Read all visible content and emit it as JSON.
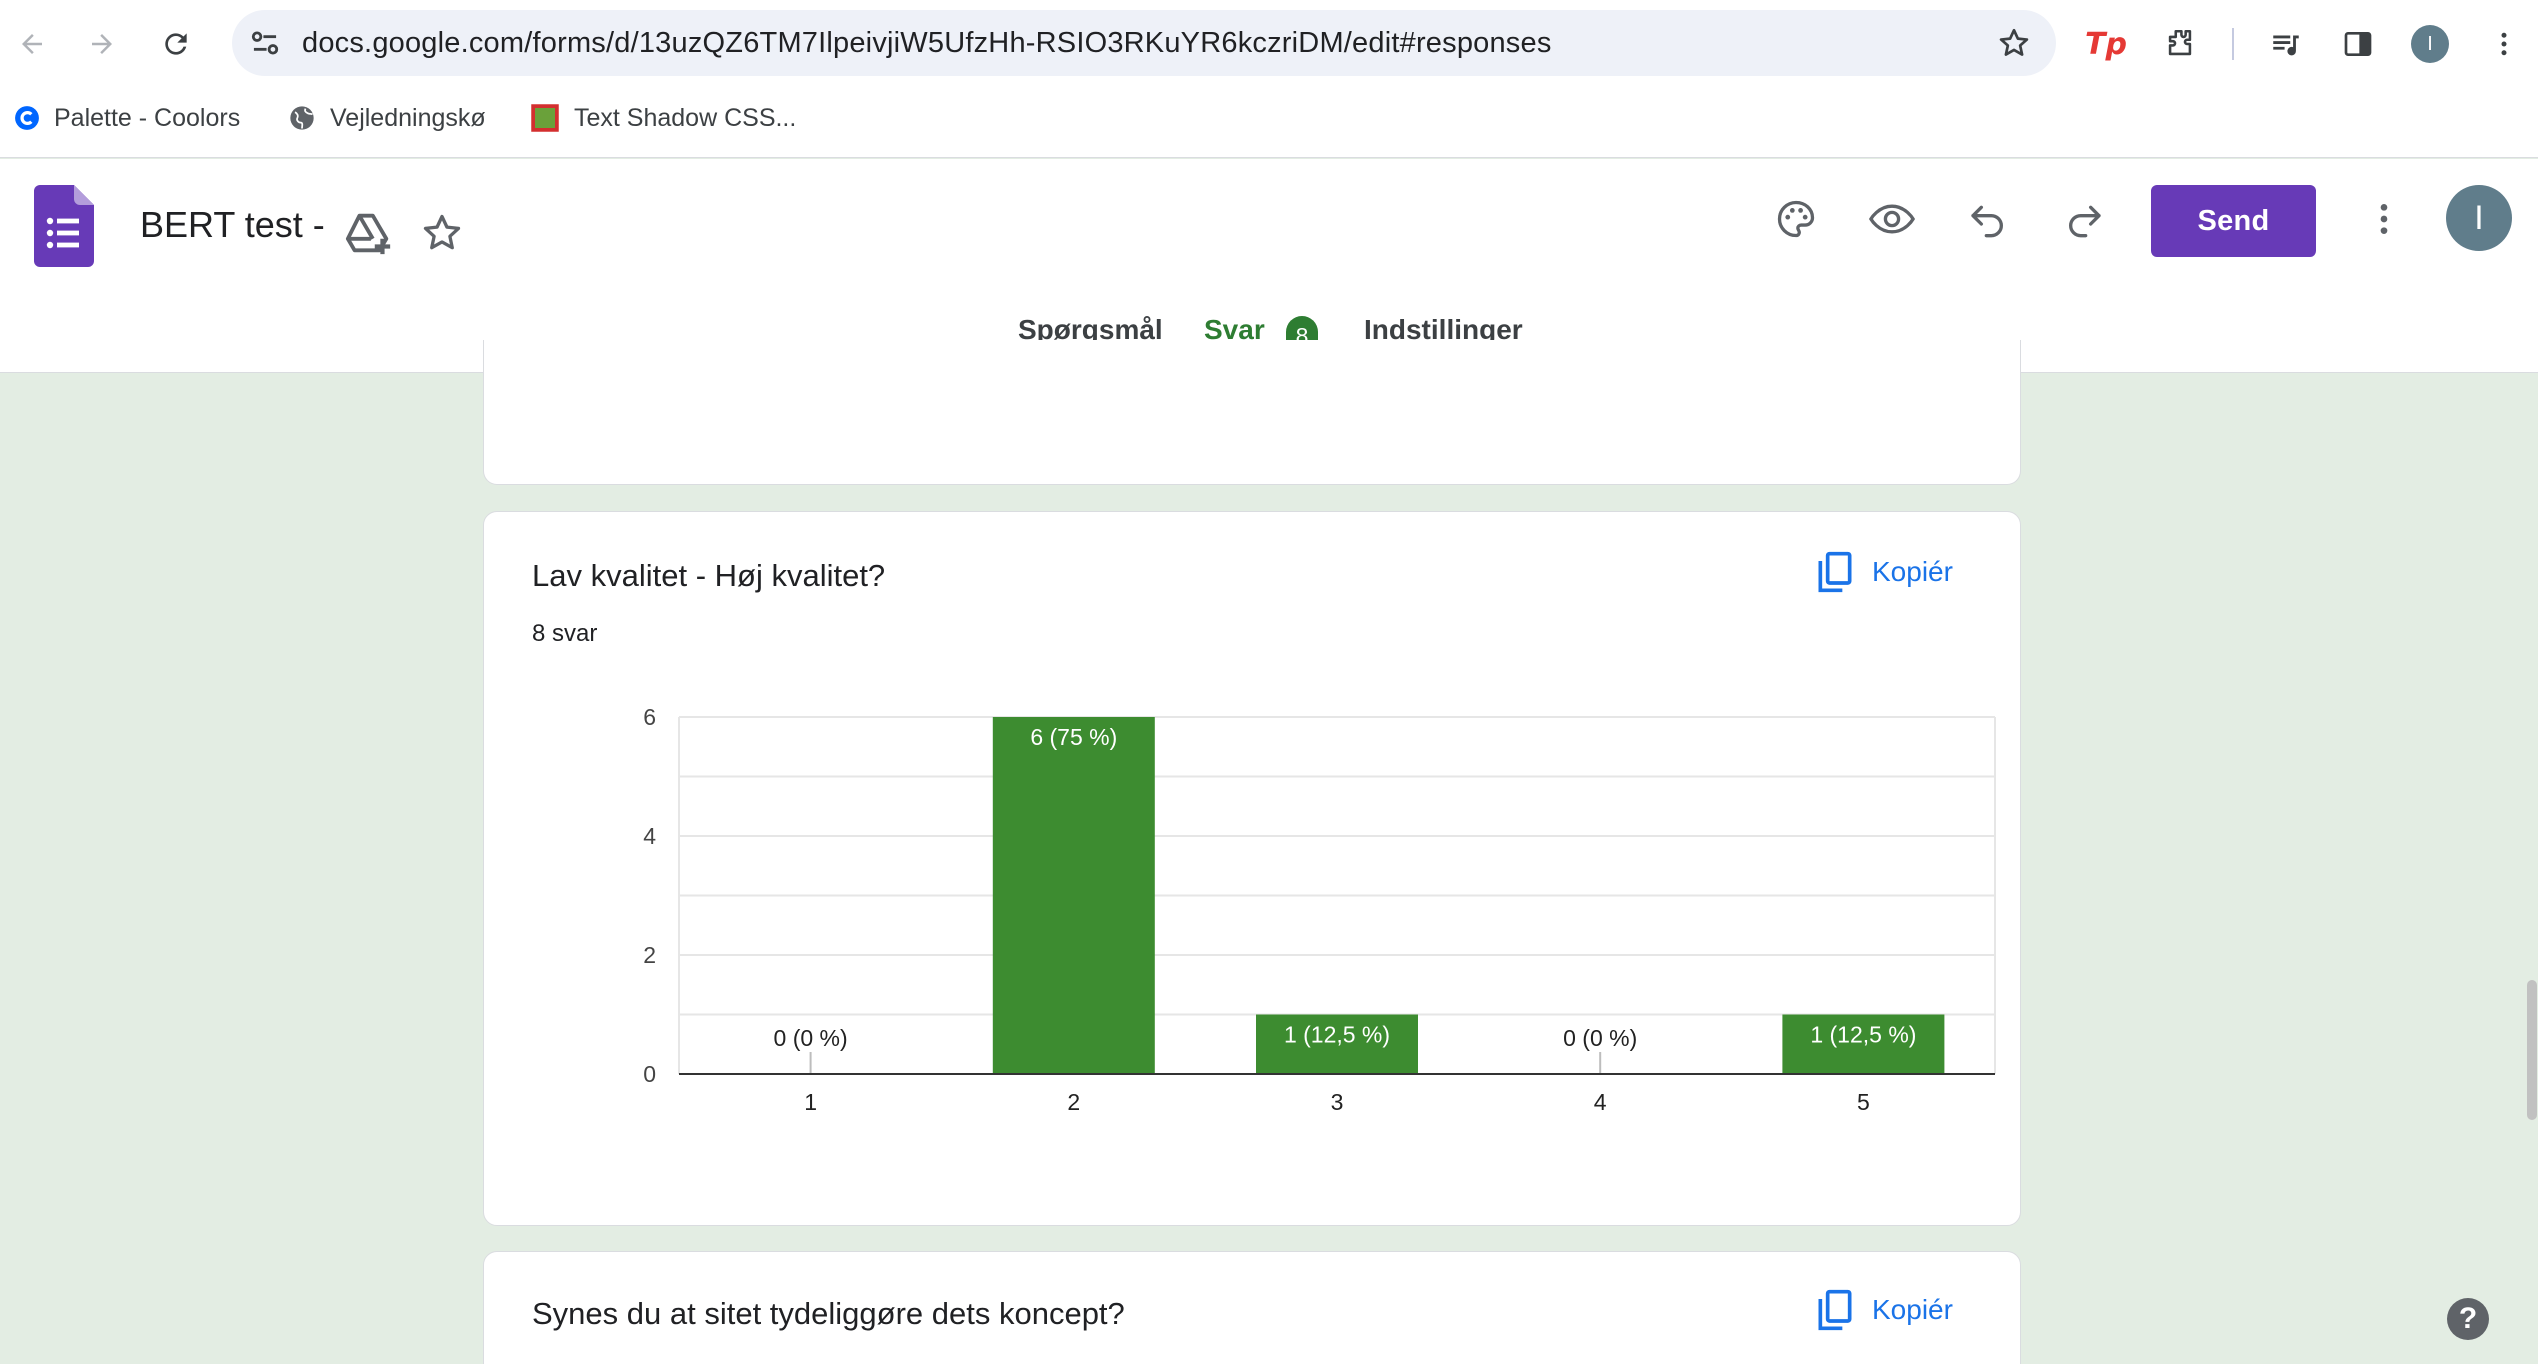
{
  "browser": {
    "url": "docs.google.com/forms/d/13uzQZ6TM7IlpeivjiW5UfzHh-RSIO3RKuYR6kczriDM/edit#responses",
    "profile_initial": "I",
    "bookmarks": [
      {
        "label": "Palette - Coolors",
        "icon": "coolors-icon"
      },
      {
        "label": "Vejledningskø",
        "icon": "globe-icon"
      },
      {
        "label": "Text Shadow CSS...",
        "icon": "square-favicon-icon"
      }
    ]
  },
  "form": {
    "title": "BERT test -",
    "send_label": "Send",
    "avatar_initial": "I",
    "tabs": [
      {
        "label": "Spørgsmål",
        "active": false
      },
      {
        "label": "Svar",
        "active": true,
        "badge": "8"
      },
      {
        "label": "Indstillinger",
        "active": false
      }
    ]
  },
  "cards": [
    {
      "title": "Lav kvalitet - Høj kvalitet?",
      "subtitle": "8 svar",
      "copy_label": "Kopiér"
    },
    {
      "title": "Synes du at sitet tydeliggøre dets koncept?",
      "copy_label": "Kopiér"
    }
  ],
  "chart_data": {
    "type": "bar",
    "categories": [
      "1",
      "2",
      "3",
      "4",
      "5"
    ],
    "values": [
      0,
      6,
      1,
      0,
      1
    ],
    "data_labels": [
      "0 (0 %)",
      "6 (75 %)",
      "1 (12,5 %)",
      "0 (0 %)",
      "1 (12,5 %)"
    ],
    "yticks": [
      "0",
      "2",
      "4",
      "6"
    ],
    "ylim": [
      0,
      6
    ],
    "grid": true,
    "bar_color": "#3d8c30"
  },
  "colors": {
    "accent": "#673ab7",
    "tab_active": "#2e7d32",
    "link": "#1a73e8",
    "background": "#e3ede3"
  }
}
